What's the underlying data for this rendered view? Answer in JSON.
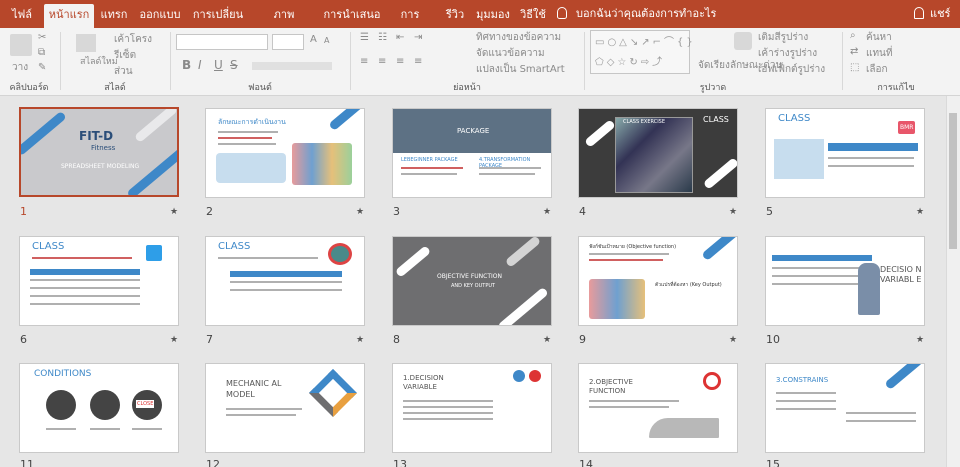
{
  "tabs": [
    "ไฟล์",
    "หน้าแรก",
    "แทรก",
    "ออกแบบ",
    "การเปลี่ยน",
    "ภาพเคลื่อนไหว",
    "การนำเสนอสไลด์",
    "การบันทึก",
    "รีวิว",
    "มุมมอง",
    "วิธีใช้"
  ],
  "tell_me": "บอกฉันว่าคุณต้องการทำอะไร",
  "user": "แชร์",
  "ribbon": {
    "groups": {
      "clipboard": "คลิปบอร์ด",
      "slides": "สไลด์",
      "font": "ฟอนต์",
      "paragraph": "ย่อหน้า",
      "drawing": "รูปวาด",
      "editing": "การแก้ไข"
    },
    "paste": "วาง",
    "new_slide": "สไลด์ใหม่",
    "layout": "เค้าโครง",
    "reset": "รีเซ็ต",
    "section": "ส่วน",
    "text_direction": "ทิศทางของข้อความ",
    "align_text": "จัดแนวข้อความ",
    "convert_smartart": "แปลงเป็น SmartArt",
    "arrange": "จัดเรียง",
    "quick_styles": "ลักษณะด่วน",
    "shape_fill": "เติมสีรูปร่าง",
    "shape_outline": "เค้าร่างรูปร่าง",
    "shape_effects": "เอฟเฟ็กต์รูปร่าง",
    "find": "ค้นหา",
    "replace": "แทนที่",
    "select": "เลือก",
    "bold": "B",
    "italic": "I",
    "underline": "U",
    "strike": "S"
  },
  "slides": [
    {
      "num": "1",
      "title": "FIT-D",
      "sub": "Fitness",
      "caption": "SPREADSHEET MODELING"
    },
    {
      "num": "2",
      "title": "ลักษณะการดำเนินงาน"
    },
    {
      "num": "3",
      "title": "PACKAGE",
      "left": "LEBEGINNER PACKAGE",
      "right": "4.TRANSFORMATION PACKAGE"
    },
    {
      "num": "4",
      "title": "CLASS EXERCISE",
      "right": "CLASS"
    },
    {
      "num": "5",
      "title": "CLASS",
      "badge": "BMR"
    },
    {
      "num": "6",
      "title": "CLASS"
    },
    {
      "num": "7",
      "title": "CLASS"
    },
    {
      "num": "8",
      "title": "OBJECTIVE FUNCTION",
      "sub": "AND KEY OUTPUT"
    },
    {
      "num": "9",
      "title": "ฟังก์ชันเป้าหมาย (Objective function)",
      "sub": "ตัวแปรที่ต้องหา (Key Output)"
    },
    {
      "num": "10",
      "title": "DECISIO N VARIABL E"
    },
    {
      "num": "11",
      "title": "CONDITIONS",
      "labels": [
        "CLOSE"
      ]
    },
    {
      "num": "12",
      "title": "MECHANIC AL MODEL"
    },
    {
      "num": "13",
      "title": "1.DECISION VARIABLE"
    },
    {
      "num": "14",
      "title": "2.OBJECTIVE FUNCTION"
    },
    {
      "num": "15",
      "title": "3.CONSTRAINS"
    }
  ],
  "colors": {
    "accent": "#b7472a",
    "blue": "#3e88c8",
    "gray": "#6e6e70"
  },
  "icons": [
    "cut-icon",
    "copy-icon",
    "format-painter-icon",
    "new-slide-icon",
    "bullets-icon",
    "numbering-icon",
    "shapes-icon",
    "find-icon",
    "replace-icon",
    "select-icon",
    "lightbulb-icon",
    "user-icon",
    "star-icon"
  ]
}
